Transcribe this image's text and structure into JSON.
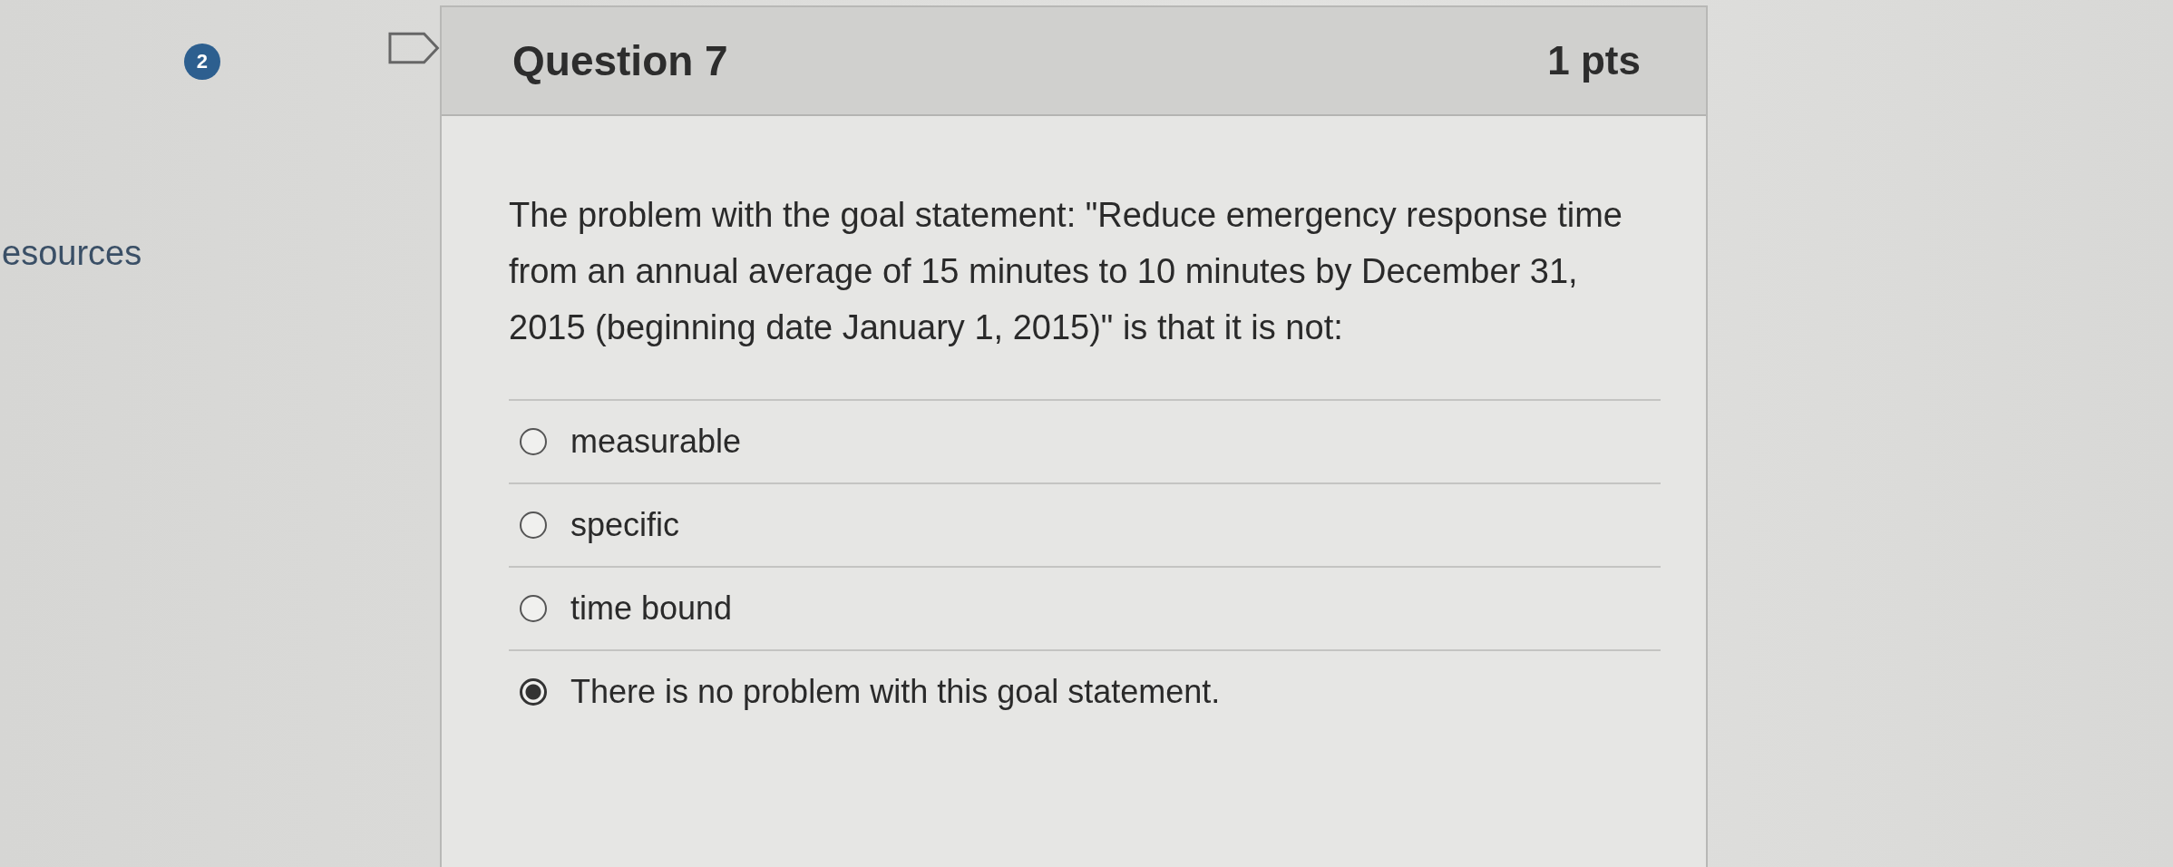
{
  "sidebar": {
    "badge": "2",
    "link": "esources"
  },
  "question": {
    "title": "Question 7",
    "points": "1 pts",
    "text": "The problem with the goal statement: \"Reduce emergency response time from an annual average of 15 minutes to 10 minutes by December 31, 2015 (beginning date January 1, 2015)\" is that it is not:",
    "answers": [
      {
        "label": "measurable",
        "selected": false
      },
      {
        "label": "specific",
        "selected": false
      },
      {
        "label": "time bound",
        "selected": false
      },
      {
        "label": "There is no problem with this goal statement.",
        "selected": true
      }
    ]
  }
}
